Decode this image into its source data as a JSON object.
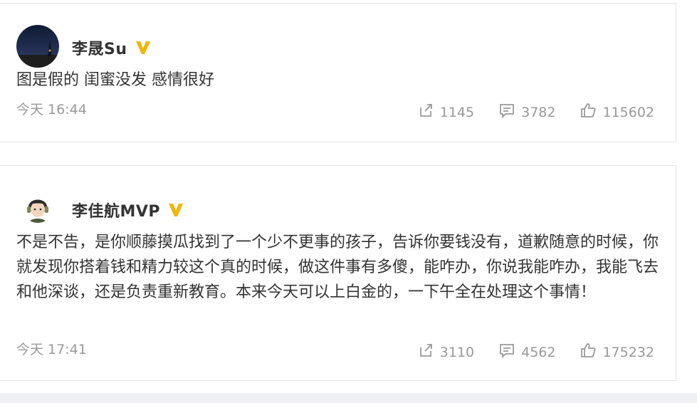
{
  "posts": [
    {
      "user": "李晟Su",
      "text": "图是假的 闺蜜没发 感情很好",
      "time": "今天 16:44",
      "repost": "1145",
      "comments": "3782",
      "likes": "115602"
    },
    {
      "user": "李佳航MVP",
      "text": "不是不告，是你顺藤摸瓜找到了一个少不更事的孩子，告诉你要钱没有，道歉随意的时候，你就发现你搭着钱和精力较这个真的时候，做这件事有多傻，能咋办，你说我能咋办，我能飞去和他深谈，还是负责重新教育。本来今天可以上白金的，一下午全在处理这个事情！",
      "time": "今天 17:41",
      "repost": "3110",
      "comments": "4562",
      "likes": "175232"
    }
  ],
  "colors": {
    "badge": "#f4b400",
    "text": "#333333",
    "meta": "#999999"
  }
}
